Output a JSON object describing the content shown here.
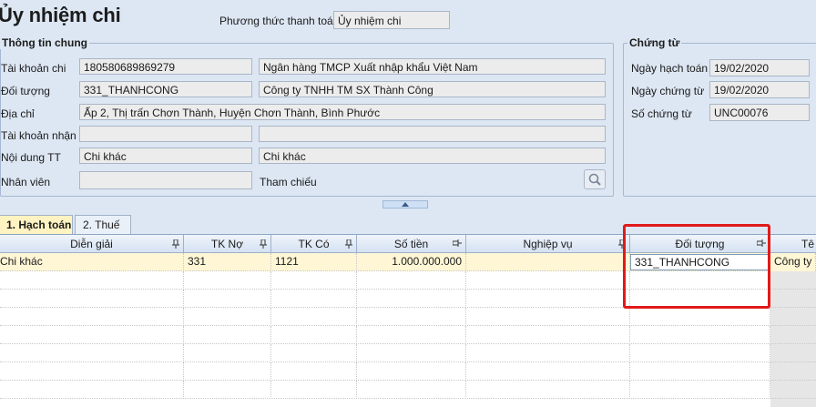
{
  "header": {
    "title": "Ủy nhiệm chi",
    "payment_method_label": "Phương thức thanh toán",
    "payment_method_value": "Ủy nhiệm chi"
  },
  "general": {
    "group_title": "Thông tin chung",
    "account_label": "Tài khoản chi",
    "account_value": "18058068986927​9",
    "bank_name": "Ngân hàng TMCP Xuất nhập khẩu Việt Nam",
    "object_label": "Đối tượng",
    "object_value": "331_THANHCONG",
    "object_name": "Công ty TNHH TM SX Thành Công",
    "address_label": "Địa chỉ",
    "address_value": "Ấp 2, Thị trấn Chơn Thành, Huyện Chơn Thành, Bình Phước",
    "receive_account_label": "Tài khoản nhận",
    "receive_account_value": "",
    "receive_bank_value": "",
    "content_label": "Nội dung TT",
    "content_value": "Chi khác",
    "content_value2": "Chi khác",
    "staff_label": "Nhân viên",
    "staff_value": "",
    "reference_label": "Tham chiếu"
  },
  "voucher": {
    "group_title": "Chứng từ",
    "accounting_date_label": "Ngày hạch toán",
    "accounting_date_value": "19/02/2020",
    "voucher_date_label": "Ngày chứng từ",
    "voucher_date_value": "19/02/2020",
    "voucher_no_label": "Số chứng từ",
    "voucher_no_value": "UNC00076"
  },
  "tabs": [
    {
      "label": "1. Hạch toán",
      "active": true
    },
    {
      "label": "2. Thuế",
      "active": false
    }
  ],
  "grid": {
    "columns": [
      "Diễn giải",
      "TK Nợ",
      "TK Có",
      "Số tiền",
      "Nghiệp vụ",
      "Đối tượng",
      "Tê"
    ],
    "rows": [
      {
        "description": "Chi khác",
        "debit": "331",
        "credit": "1121",
        "amount": "1.000.000.000",
        "operation": "",
        "object": "331_THANHCONG",
        "name": "Công ty T"
      }
    ]
  },
  "colors": {
    "background": "#dde7f3",
    "selected_row": "#fff6d5",
    "active_tab": "#fff3c2",
    "highlight_box": "#e11a1a"
  }
}
